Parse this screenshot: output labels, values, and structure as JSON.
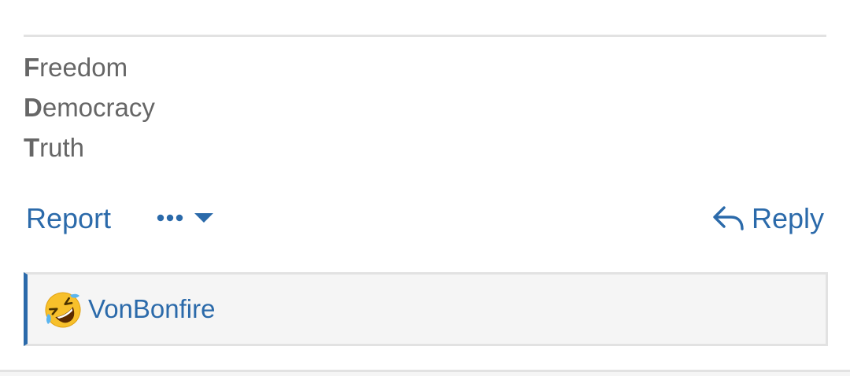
{
  "signature": {
    "lines": [
      {
        "initial": "F",
        "rest": "reedom"
      },
      {
        "initial": "D",
        "rest": "emocracy"
      },
      {
        "initial": "T",
        "rest": "ruth"
      }
    ]
  },
  "actions": {
    "report_label": "Report",
    "more_icon": "ellipsis-icon",
    "dropdown_icon": "caret-down-icon",
    "reply_label": "Reply",
    "reply_icon": "reply-arrow-icon"
  },
  "reactions": {
    "emoji": "rolling-on-floor-laughing-emoji",
    "user": "VonBonfire"
  },
  "colors": {
    "link": "#2b6aaa",
    "text_muted": "#666666",
    "divider": "#e2e2e2",
    "reaction_bg": "#f5f5f5"
  }
}
